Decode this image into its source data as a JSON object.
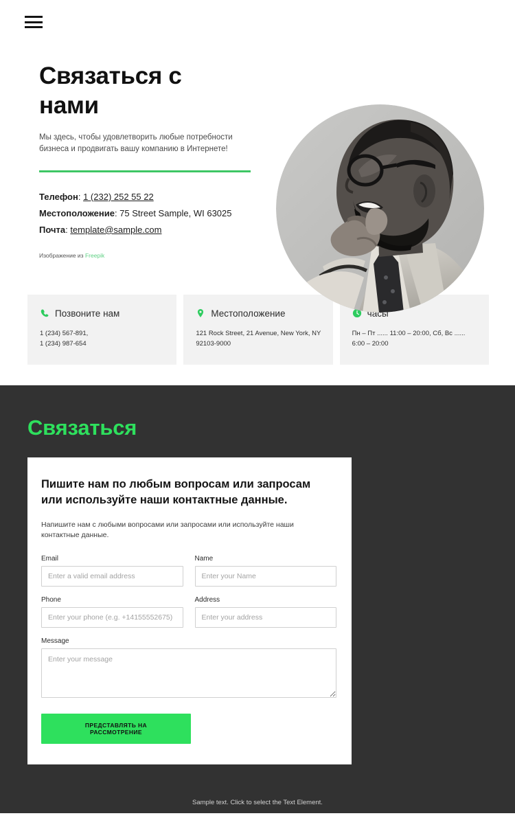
{
  "header": {
    "menu_label": "menu"
  },
  "hero": {
    "title": "Связаться с нами",
    "subtitle": "Мы здесь, чтобы удовлетворить любые потребности бизнеса и продвигать вашу компанию в Интернете!",
    "contacts": [
      {
        "label": "Телефон",
        "value": "1 (232) 252 55 22",
        "link": true
      },
      {
        "label": "Местоположение",
        "value": "75 Street Sample, WI 63025",
        "link": false
      },
      {
        "label": "Почта",
        "value": "template@sample.com",
        "link": true
      }
    ],
    "credit_prefix": "Изображение из",
    "credit_link": "Freepik",
    "photo_alt": "portrait-photo",
    "accent_rule_color": "#3ec664"
  },
  "cards": [
    {
      "icon": "phone-icon",
      "title": "Позвоните нам",
      "body": "1 (234) 567-891,\n1 (234) 987-654"
    },
    {
      "icon": "map-pin-icon",
      "title": "Местоположение",
      "body": "121 Rock Street, 21 Avenue, New York, NY 92103-9000"
    },
    {
      "icon": "clock-icon",
      "title": "часы",
      "body": "Пн – Пт ...... 11:00 – 20:00, Сб, Вс  ...... 6:00 – 20:00"
    }
  ],
  "contact_section": {
    "heading": "Связаться",
    "heading_color": "#2ee05d",
    "background_color": "#323232",
    "form": {
      "title": "Пишите нам по любым вопросам или запросам\nили используйте наши контактные данные.",
      "intro": "Напишите нам с любыми вопросами или запросами или используйте наши контактные данные.",
      "fields": [
        {
          "label": "Email",
          "placeholder": "Enter a valid email address",
          "value": ""
        },
        {
          "label": "Name",
          "placeholder": "Enter your Name",
          "value": ""
        },
        {
          "label": "Phone",
          "placeholder": "Enter your phone (e.g. +14155552675)",
          "value": ""
        },
        {
          "label": "Address",
          "placeholder": "Enter your address",
          "value": ""
        },
        {
          "label": "Message",
          "placeholder": "Enter your message",
          "value": ""
        }
      ],
      "submit_label": "ПРЕДСТАВЛЯТЬ НА РАССМОТРЕНИЕ",
      "submit_color": "#2ee05d"
    }
  },
  "footer": {
    "note": "Sample text. Click to select the Text Element."
  }
}
